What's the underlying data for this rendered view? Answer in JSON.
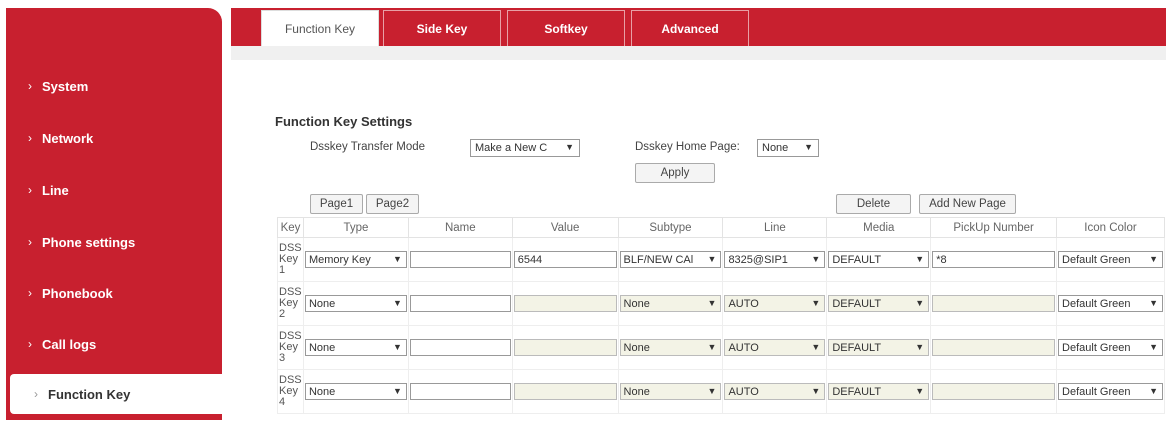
{
  "sidebar": {
    "items": [
      {
        "label": "System"
      },
      {
        "label": "Network"
      },
      {
        "label": "Line"
      },
      {
        "label": "Phone settings"
      },
      {
        "label": "Phonebook"
      },
      {
        "label": "Call logs"
      },
      {
        "label": "Function Key"
      }
    ],
    "arrow": "›"
  },
  "tabs": [
    "Function Key",
    "Side Key",
    "Softkey",
    "Advanced"
  ],
  "settings": {
    "title": "Function Key Settings",
    "transfer_mode_label": "Dsskey Transfer Mode",
    "transfer_mode_value": "Make a New C",
    "home_page_label": "Dsskey Home Page:",
    "home_page_value": "None",
    "apply_label": "Apply"
  },
  "pages": [
    "Page1",
    "Page2"
  ],
  "delete_label": "Delete",
  "add_page_label": "Add New Page",
  "caret": "▼",
  "table": {
    "headers": [
      "Key",
      "Type",
      "Name",
      "Value",
      "Subtype",
      "Line",
      "Media",
      "PickUp Number",
      "Icon Color"
    ],
    "rows": [
      {
        "key_a": "DSS",
        "key_b": "Key",
        "key_c": "1",
        "type": "Memory Key",
        "name": "",
        "value": "6544",
        "subtype": "BLF/NEW CAl",
        "line": "8325@SIP1",
        "media": "DEFAULT",
        "pickup": "*8",
        "icon": "Default Green"
      },
      {
        "key_a": "DSS",
        "key_b": "Key",
        "key_c": "2",
        "type": "None",
        "name": "",
        "value": "",
        "subtype": "None",
        "line": "AUTO",
        "media": "DEFAULT",
        "pickup": "",
        "icon": "Default Green"
      },
      {
        "key_a": "DSS",
        "key_b": "Key",
        "key_c": "3",
        "type": "None",
        "name": "",
        "value": "",
        "subtype": "None",
        "line": "AUTO",
        "media": "DEFAULT",
        "pickup": "",
        "icon": "Default Green"
      },
      {
        "key_a": "DSS",
        "key_b": "Key",
        "key_c": "4",
        "type": "None",
        "name": "",
        "value": "",
        "subtype": "None",
        "line": "AUTO",
        "media": "DEFAULT",
        "pickup": "",
        "icon": "Default Green"
      }
    ]
  },
  "colors": {
    "brand": "#c8202f"
  }
}
